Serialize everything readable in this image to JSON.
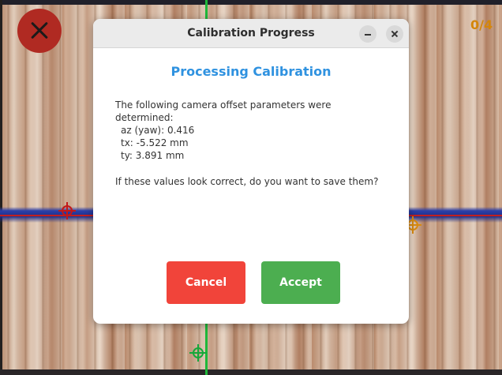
{
  "overlay": {
    "progress": "0/4"
  },
  "dialog": {
    "title": "Calibration Progress",
    "heading": "Processing Calibration",
    "intro": "The following camera offset parameters were determined:",
    "params": [
      "az (yaw): 0.416",
      "tx: -5.522 mm",
      "ty: 3.891 mm"
    ],
    "question": "If these values look correct, do you want to save them?",
    "cancel_label": "Cancel",
    "accept_label": "Accept"
  },
  "colors": {
    "heading": "#2f92e0",
    "cancel": "#f1443a",
    "accept": "#4cae50",
    "close_button": "#b02a22",
    "progress": "#d4860a"
  },
  "icons": {
    "camera_close": "close-icon",
    "window_minimize": "minimize-icon",
    "window_close": "close-icon"
  }
}
